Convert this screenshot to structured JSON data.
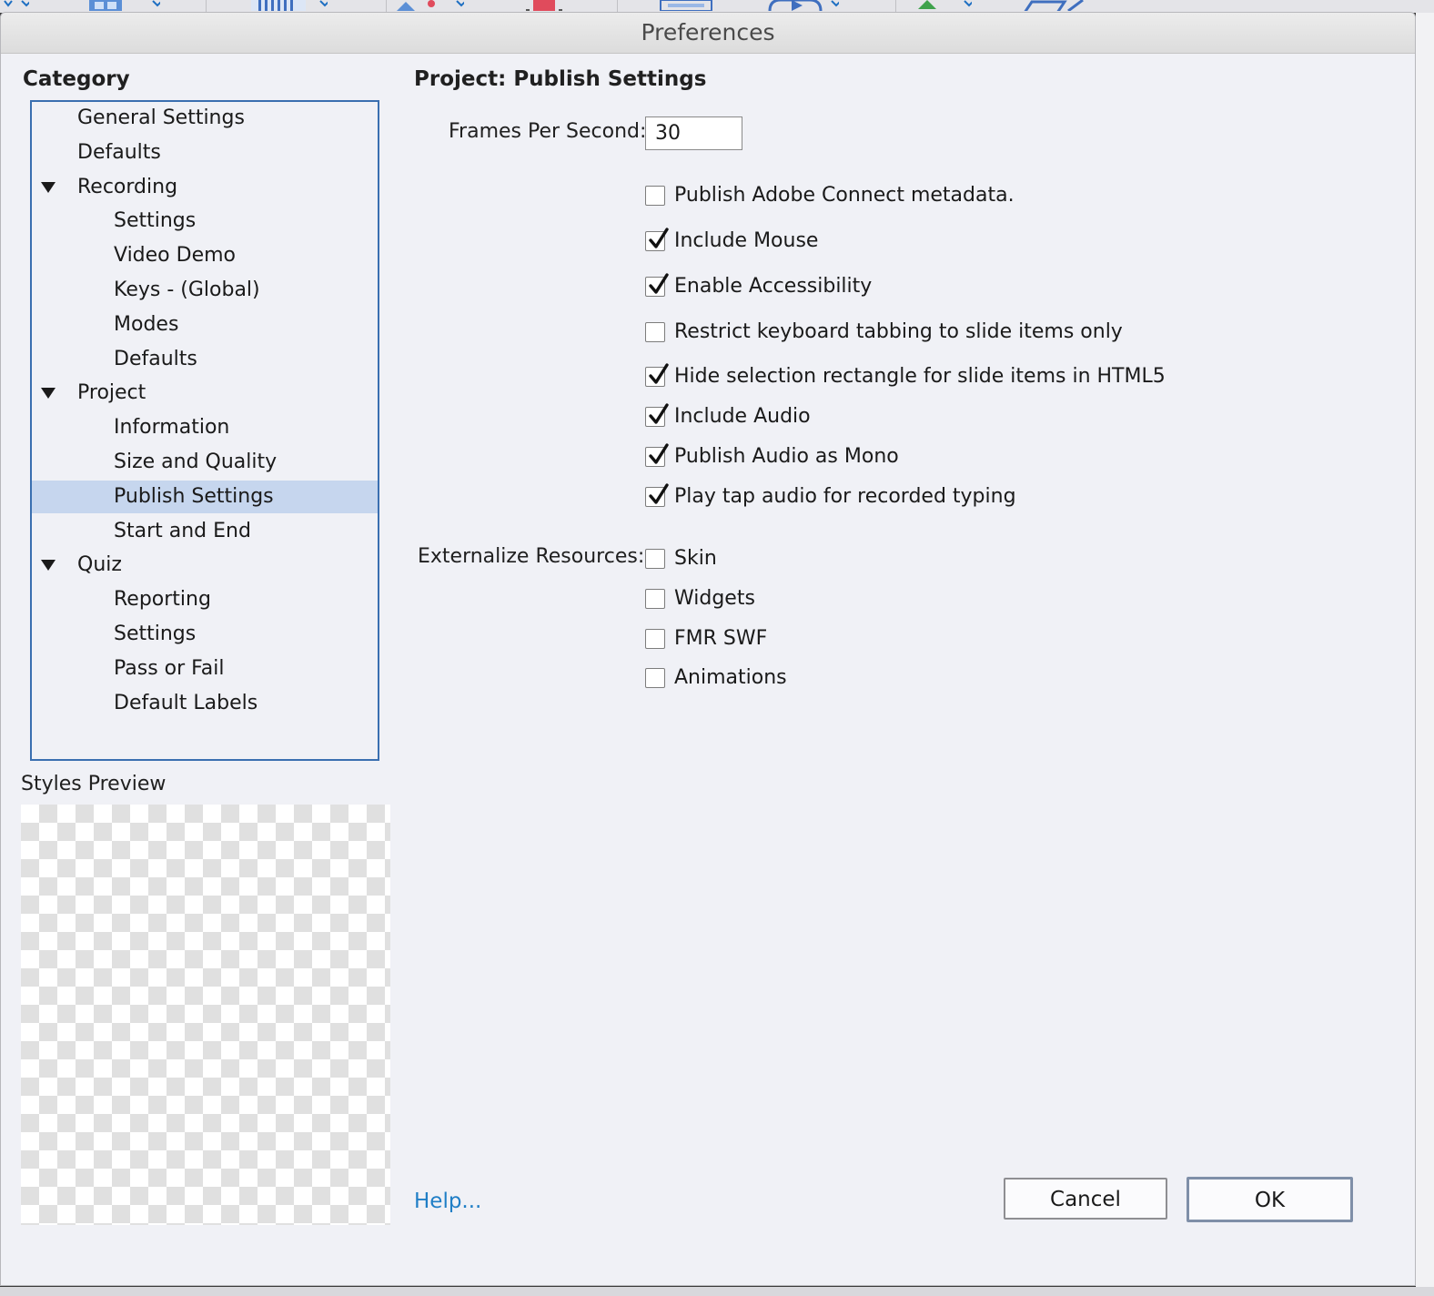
{
  "dialog": {
    "title": "Preferences"
  },
  "category": {
    "heading": "Category",
    "items": [
      {
        "label": "General Settings",
        "level": 0,
        "expandable": false
      },
      {
        "label": "Defaults",
        "level": 0,
        "expandable": false
      },
      {
        "label": "Recording",
        "level": 0,
        "expandable": true,
        "expanded": true
      },
      {
        "label": "Settings",
        "level": 1,
        "expandable": false
      },
      {
        "label": "Video Demo",
        "level": 1,
        "expandable": false
      },
      {
        "label": "Keys - (Global)",
        "level": 1,
        "expandable": false
      },
      {
        "label": "Modes",
        "level": 1,
        "expandable": false
      },
      {
        "label": "Defaults",
        "level": 1,
        "expandable": false
      },
      {
        "label": "Project",
        "level": 0,
        "expandable": true,
        "expanded": true
      },
      {
        "label": "Information",
        "level": 1,
        "expandable": false
      },
      {
        "label": "Size and Quality",
        "level": 1,
        "expandable": false
      },
      {
        "label": "Publish Settings",
        "level": 1,
        "expandable": false,
        "selected": true
      },
      {
        "label": "Start and End",
        "level": 1,
        "expandable": false
      },
      {
        "label": "Quiz",
        "level": 0,
        "expandable": true,
        "expanded": true
      },
      {
        "label": "Reporting",
        "level": 1,
        "expandable": false
      },
      {
        "label": "Settings",
        "level": 1,
        "expandable": false
      },
      {
        "label": "Pass or Fail",
        "level": 1,
        "expandable": false
      },
      {
        "label": "Default Labels",
        "level": 1,
        "expandable": false
      }
    ]
  },
  "styles_preview": {
    "label": "Styles Preview"
  },
  "panel": {
    "title": "Project: Publish Settings",
    "fps_label": "Frames Per Second:",
    "fps_value": "30",
    "options": [
      {
        "label": "Publish Adobe Connect metadata.",
        "checked": false
      },
      {
        "label": "Include Mouse",
        "checked": true
      },
      {
        "label": "Enable Accessibility",
        "checked": true
      },
      {
        "label": "Restrict keyboard tabbing to slide items only",
        "checked": false
      },
      {
        "label": "Hide selection rectangle for slide items in HTML5",
        "checked": true
      },
      {
        "label": "Include Audio",
        "checked": true
      },
      {
        "label": "Publish Audio as Mono",
        "checked": true
      },
      {
        "label": "Play tap audio for recorded typing",
        "checked": true
      }
    ],
    "externalize_label": "Externalize Resources:",
    "externalize": [
      {
        "label": "Skin",
        "checked": false
      },
      {
        "label": "Widgets",
        "checked": false
      },
      {
        "label": "FMR SWF",
        "checked": false
      },
      {
        "label": "Animations",
        "checked": false
      }
    ]
  },
  "footer": {
    "help": "Help...",
    "cancel": "Cancel",
    "ok": "OK"
  }
}
